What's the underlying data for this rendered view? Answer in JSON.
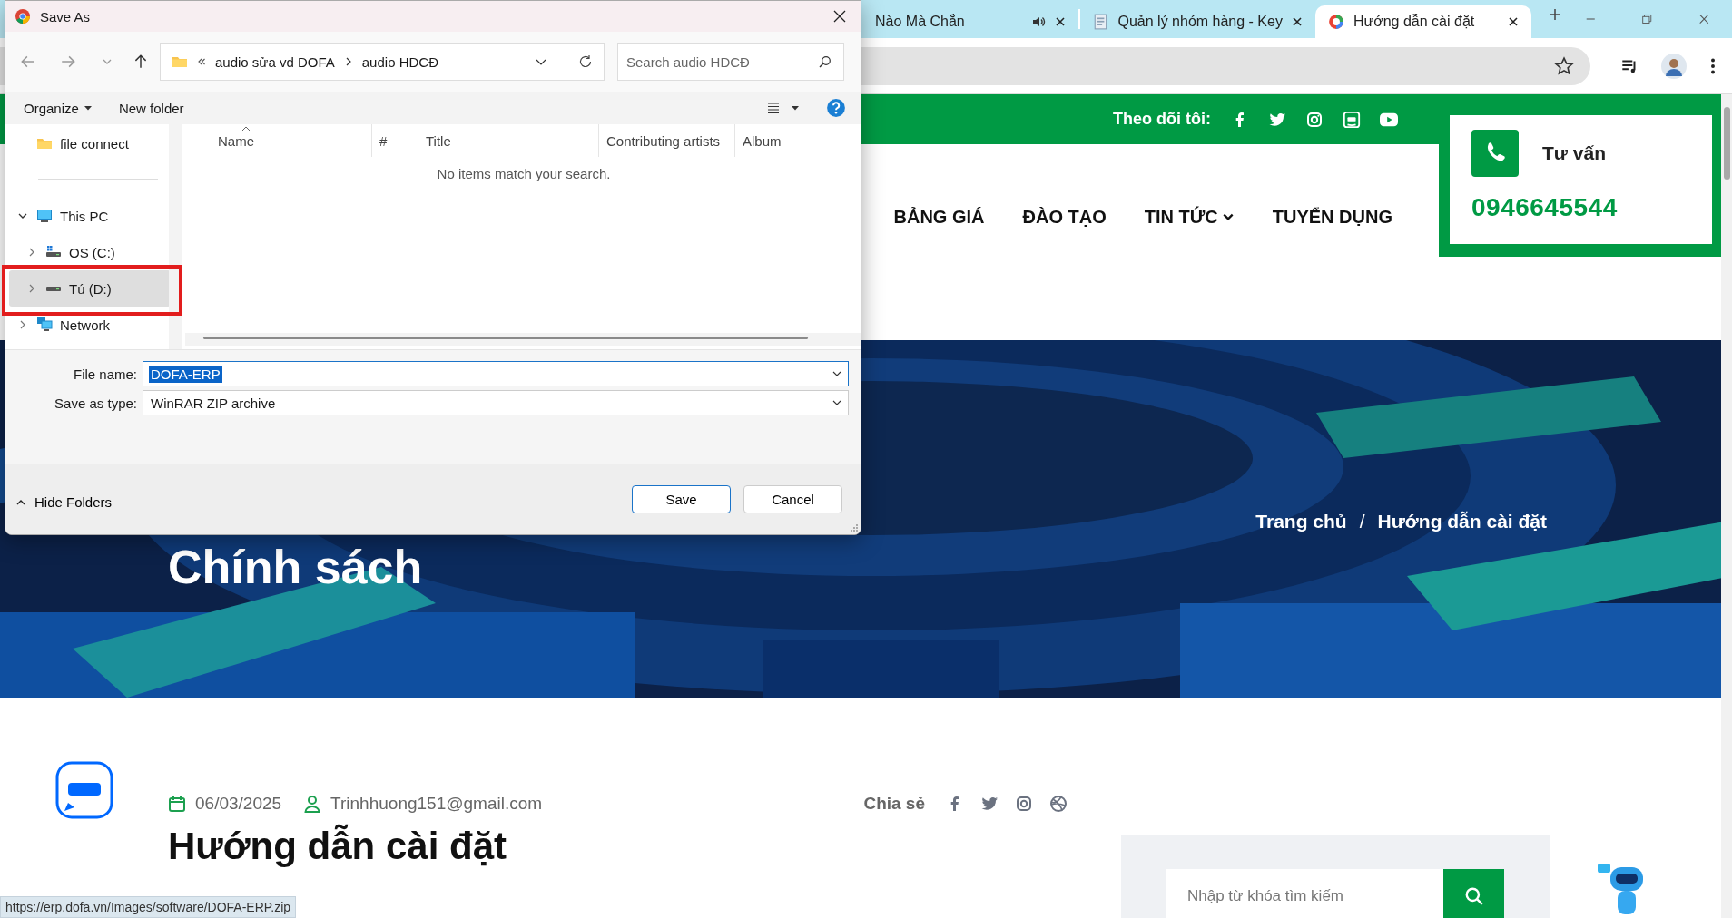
{
  "browser": {
    "tabs": [
      {
        "title": "Nào Mà Chẳn",
        "selected": false,
        "audio": true
      },
      {
        "title": "Quản lý nhóm hàng - Key",
        "selected": false,
        "audio": false
      },
      {
        "title": "Hướng dẫn cài đặt",
        "selected": true,
        "audio": false
      }
    ],
    "bookmarked": false,
    "status_url": "https://erp.dofa.vn/Images/software/DOFA-ERP.zip"
  },
  "site": {
    "follow_label": "Theo dõi tôi:",
    "nav": [
      {
        "label": "BẢNG GIÁ",
        "has_menu": false
      },
      {
        "label": "ĐÀO TẠO",
        "has_menu": false
      },
      {
        "label": "TIN TỨC",
        "has_menu": true
      },
      {
        "label": "TUYỂN DỤNG",
        "has_menu": false
      }
    ],
    "contact": {
      "label": "Tư vấn",
      "phone": "0946645544"
    },
    "hero": {
      "title": "Chính sách",
      "breadcrumb": [
        "Trang chủ",
        "Hướng dẫn cài đặt"
      ],
      "separator": "/"
    },
    "post": {
      "date": "06/03/2025",
      "author": "Trinhhuong151@gmail.com",
      "share_label": "Chia sẻ",
      "title": "Hướng dẫn cài đặt"
    },
    "sidebar": {
      "search_placeholder": "Nhập từ khóa tìm kiếm"
    }
  },
  "dialog": {
    "title": "Save As",
    "path": [
      "audio sửa vd DOFA",
      "audio HDCĐ"
    ],
    "search_placeholder": "Search audio HDCĐ",
    "commands": [
      {
        "label": "Organize",
        "has_menu": true
      },
      {
        "label": "New folder",
        "has_menu": false
      }
    ],
    "nav_items": [
      {
        "label": "file connect",
        "kind": "folder",
        "selected": false
      },
      {
        "label": "This PC",
        "kind": "pc",
        "selected": false,
        "expanded": true,
        "children": [
          {
            "label": "OS (C:)",
            "kind": "system-drive",
            "selected": false,
            "expanded": false
          },
          {
            "label": "Tú (D:)",
            "kind": "drive",
            "selected": true,
            "expanded": false
          }
        ]
      },
      {
        "label": "Network",
        "kind": "network",
        "selected": false,
        "expanded": false
      }
    ],
    "columns": [
      {
        "label": "Name",
        "sorted": true
      },
      {
        "label": "#",
        "sorted": false
      },
      {
        "label": "Title",
        "sorted": false
      },
      {
        "label": "Contributing artists",
        "sorted": false
      },
      {
        "label": "Album",
        "sorted": false
      }
    ],
    "empty_message": "No items match your search.",
    "file_name_label": "File name:",
    "file_name": "DOFA-ERP",
    "file_name_selected": true,
    "type_label": "Save as type:",
    "type": "WinRAR ZIP archive",
    "hide_folders": "Hide Folders",
    "buttons": [
      {
        "label": "Save",
        "primary": true
      },
      {
        "label": "Cancel",
        "primary": false
      }
    ]
  }
}
